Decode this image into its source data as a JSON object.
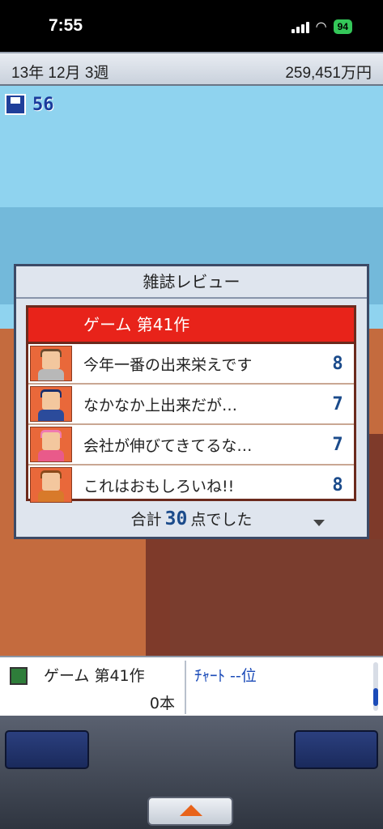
{
  "status": {
    "time": "7:55",
    "battery": "94"
  },
  "topbar": {
    "date": "13年 12月 3週",
    "money": "259,451万円"
  },
  "disks": {
    "count": "56"
  },
  "review": {
    "title": "雑誌レビュー",
    "game_title": "ゲーム 第41作",
    "rows": [
      {
        "text": "今年一番の出来栄えです",
        "score": "8"
      },
      {
        "text": "なかなか上出来だが…",
        "score": "7"
      },
      {
        "text": "会社が伸びてきてるな…",
        "score": "7"
      },
      {
        "text": "これはおもしろいね!!",
        "score": "8"
      }
    ],
    "total_prefix": "合計",
    "total_value": "30",
    "total_suffix": "点でした"
  },
  "info": {
    "game_name": "ゲーム 第41作",
    "sales": "0本",
    "chart": "ﾁｬｰﾄ --位"
  },
  "colors": {
    "title_bar": "#e8231a",
    "score": "#1b4b8b",
    "accent": "#1b4bb8"
  }
}
